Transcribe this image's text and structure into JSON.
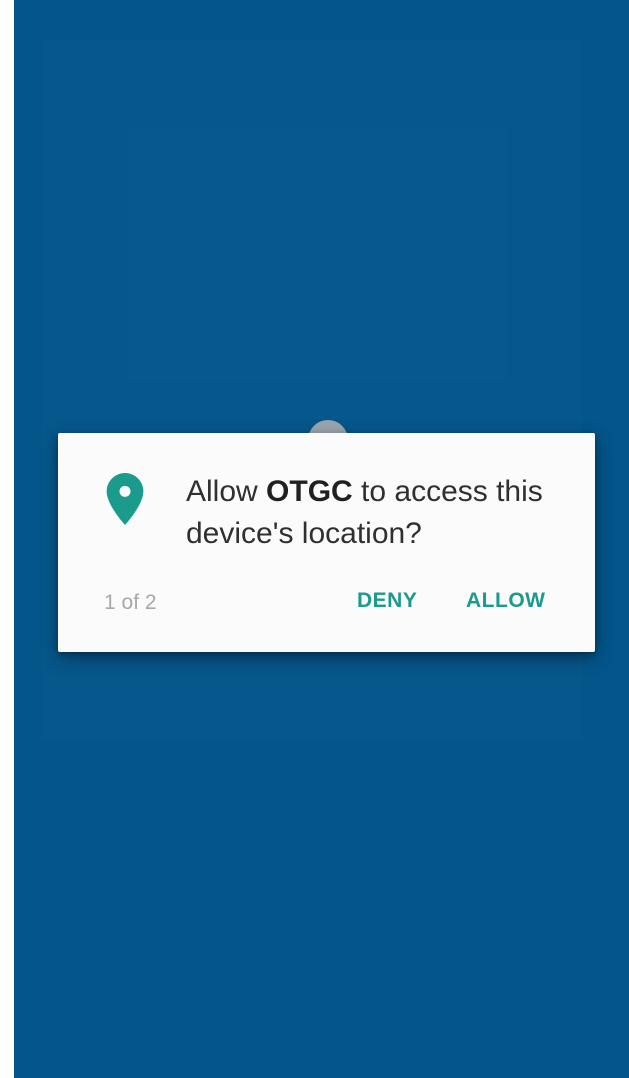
{
  "dialog": {
    "message_prefix": "Allow ",
    "app_name": "OTGC",
    "message_suffix": " to access this device's location?",
    "counter": "1 of 2",
    "deny_label": "DENY",
    "allow_label": "ALLOW",
    "icon": "location-pin-icon"
  },
  "colors": {
    "background": "#03558a",
    "dialog": "#fbfbfb",
    "accent": "#1b9b8c",
    "text": "#303030",
    "muted": "#a8a8a8"
  }
}
